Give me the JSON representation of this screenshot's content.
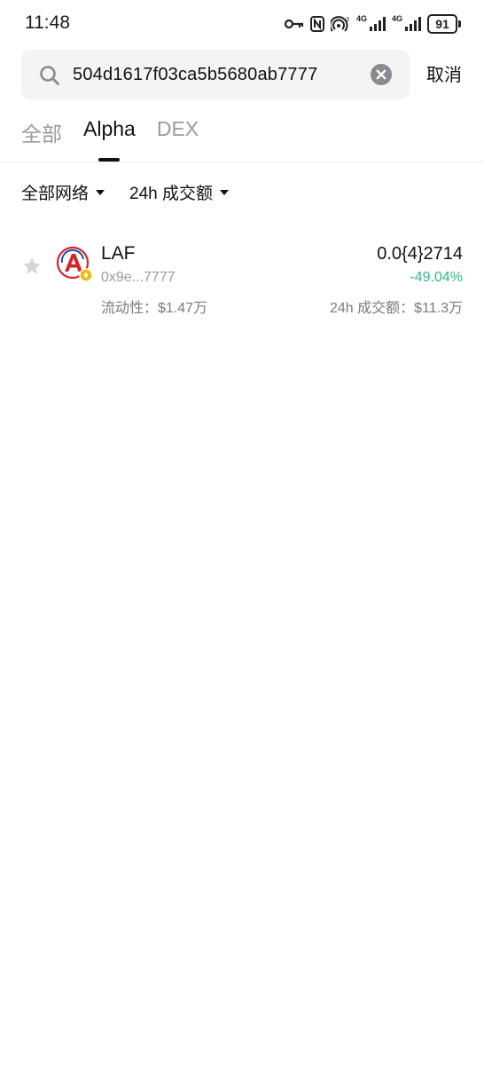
{
  "status_bar": {
    "time": "11:48",
    "battery": "91",
    "network_a": "4G",
    "network_b": "4G",
    "icons": [
      "key-icon",
      "nfc-icon",
      "hotspot-icon",
      "signal-icon",
      "signal-icon",
      "battery-icon"
    ]
  },
  "search": {
    "value": "504d1617f03ca5b5680ab7777",
    "placeholder": "",
    "cancel_label": "取消"
  },
  "tabs": [
    {
      "label": "全部",
      "active": false
    },
    {
      "label": "Alpha",
      "active": true
    },
    {
      "label": "DEX",
      "active": false
    }
  ],
  "filters": {
    "network_label": "全部网络",
    "sort_label": "24h 成交额"
  },
  "results": [
    {
      "name": "LAF",
      "address": "0x9e...7777",
      "liquidity": "流动性：$1.47万",
      "price": "0.0{4}2714",
      "change": "-49.04%",
      "volume": "24h 成交额：$11.3万",
      "change_color": "#2eb88a"
    }
  ],
  "colors": {
    "accent_text": "#111111",
    "muted_text": "#9a9aa0",
    "positive_change": "#2eb88a",
    "search_bg": "#f4f4f5"
  }
}
